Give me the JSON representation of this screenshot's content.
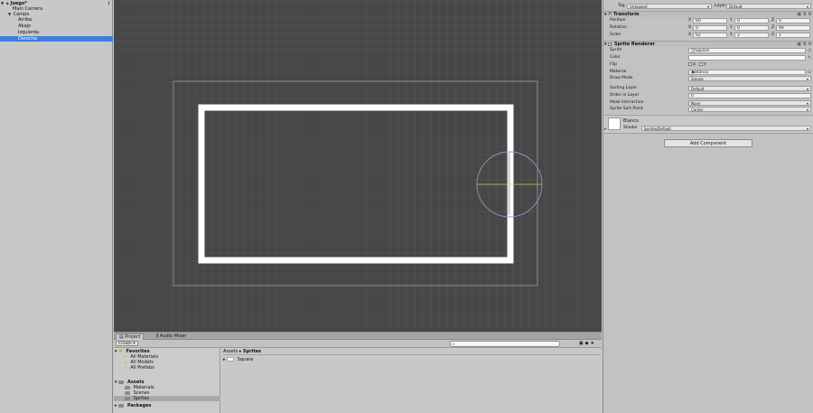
{
  "hierarchy": {
    "scene": "Juego*",
    "menu_icon": "menu-icon",
    "items": [
      {
        "label": "Main Camera"
      },
      {
        "label": "Campo"
      },
      {
        "label": "Arriba"
      },
      {
        "label": "Abajo"
      },
      {
        "label": "Izquierda"
      },
      {
        "label": "Derecha"
      }
    ]
  },
  "project": {
    "tabs": [
      {
        "label": "Project"
      },
      {
        "label": "Audio Mixer"
      }
    ],
    "create_label": "Create",
    "favorites": {
      "label": "Favorites",
      "items": [
        {
          "label": "All Materials"
        },
        {
          "label": "All Models"
        },
        {
          "label": "All Prefabs"
        }
      ]
    },
    "assets": {
      "label": "Assets",
      "items": [
        {
          "label": "Materials"
        },
        {
          "label": "Scenes"
        },
        {
          "label": "Sprites"
        }
      ]
    },
    "packages_label": "Packages",
    "breadcrumb": {
      "root": "Assets",
      "sep": "▸",
      "current": "Sprites"
    },
    "files": [
      {
        "label": "Square"
      }
    ]
  },
  "inspector": {
    "tag_label": "Tag",
    "tag_value": "Untagged",
    "layer_label": "Layer",
    "layer_value": "Default",
    "transform": {
      "title": "Transform",
      "position": {
        "label": "Position",
        "x": "60",
        "y": "0",
        "z": "0"
      },
      "rotation": {
        "label": "Rotation",
        "x": "0",
        "y": "0",
        "z": "90"
      },
      "scale": {
        "label": "Scale",
        "x": "62",
        "y": "2",
        "z": "1"
      }
    },
    "sprite_renderer": {
      "title": "Sprite Renderer",
      "sprite_label": "Sprite",
      "sprite_value": "Square",
      "color_label": "Color",
      "flip_label": "Flip",
      "flip_x": "X",
      "flip_y": "Y",
      "material_label": "Material",
      "material_value": "Blanco",
      "draw_mode_label": "Draw Mode",
      "draw_mode_value": "Simple",
      "sorting_layer_label": "Sorting Layer",
      "sorting_layer_value": "Default",
      "order_label": "Order in Layer",
      "order_value": "0",
      "mask_label": "Mask Interaction",
      "mask_value": "None",
      "sort_point_label": "Sprite Sort Point",
      "sort_point_value": "Center"
    },
    "material": {
      "name": "Blanco",
      "shader_label": "Shader",
      "shader_value": "Sprites/Default"
    },
    "add_component_label": "Add Component"
  },
  "colors": {
    "selection": "#3e7ce0",
    "scene_bg": "#474747",
    "camera_frame": "#9a9a9a",
    "gizmo_circle": "#8b98c8",
    "gizmo_axis": "#c8c860"
  }
}
